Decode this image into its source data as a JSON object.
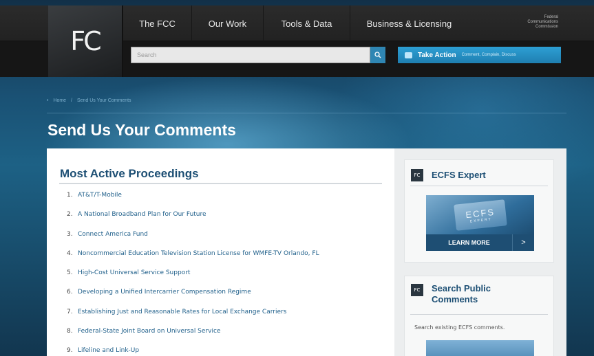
{
  "header": {
    "nav": [
      "The FCC",
      "Our Work",
      "Tools & Data",
      "Business & Licensing"
    ],
    "agency": [
      "Federal",
      "Communications",
      "Commission"
    ],
    "logo": "FC",
    "search_placeholder": "Search",
    "take_action": {
      "label": "Take Action",
      "sub": "Comment, Complain, Discuss"
    }
  },
  "breadcrumb": [
    "Home",
    "/",
    "Send Us Your Comments"
  ],
  "page_title": "Send Us Your Comments",
  "main": {
    "title": "Most Active Proceedings",
    "items": [
      {
        "num": "1.",
        "label": "AT&T/T-Mobile"
      },
      {
        "num": "2.",
        "label": "A National Broadband Plan for Our Future"
      },
      {
        "num": "3.",
        "label": "Connect America Fund"
      },
      {
        "num": "4.",
        "label": "Noncommercial Education Television Station License for WMFE-TV Orlando, FL"
      },
      {
        "num": "5.",
        "label": "High-Cost Universal Service Support"
      },
      {
        "num": "6.",
        "label": "Developing a Unified Intercarrier Compensation Regime"
      },
      {
        "num": "7.",
        "label": "Establishing Just and Reasonable Rates for Local Exchange Carriers"
      },
      {
        "num": "8.",
        "label": "Federal-State Joint Board on Universal Service"
      },
      {
        "num": "9.",
        "label": "Lifeline and Link-Up"
      }
    ]
  },
  "sidebar": {
    "ecfs": {
      "title": "ECFS Expert",
      "image_word": "ECFS",
      "image_sub": "EXPERT",
      "button": "LEARN MORE",
      "arrow": ">"
    },
    "search_comments": {
      "title_line1": "Search Public",
      "title_line2": "Comments",
      "desc": "Search existing ECFS comments."
    },
    "card_icon": "FC"
  }
}
